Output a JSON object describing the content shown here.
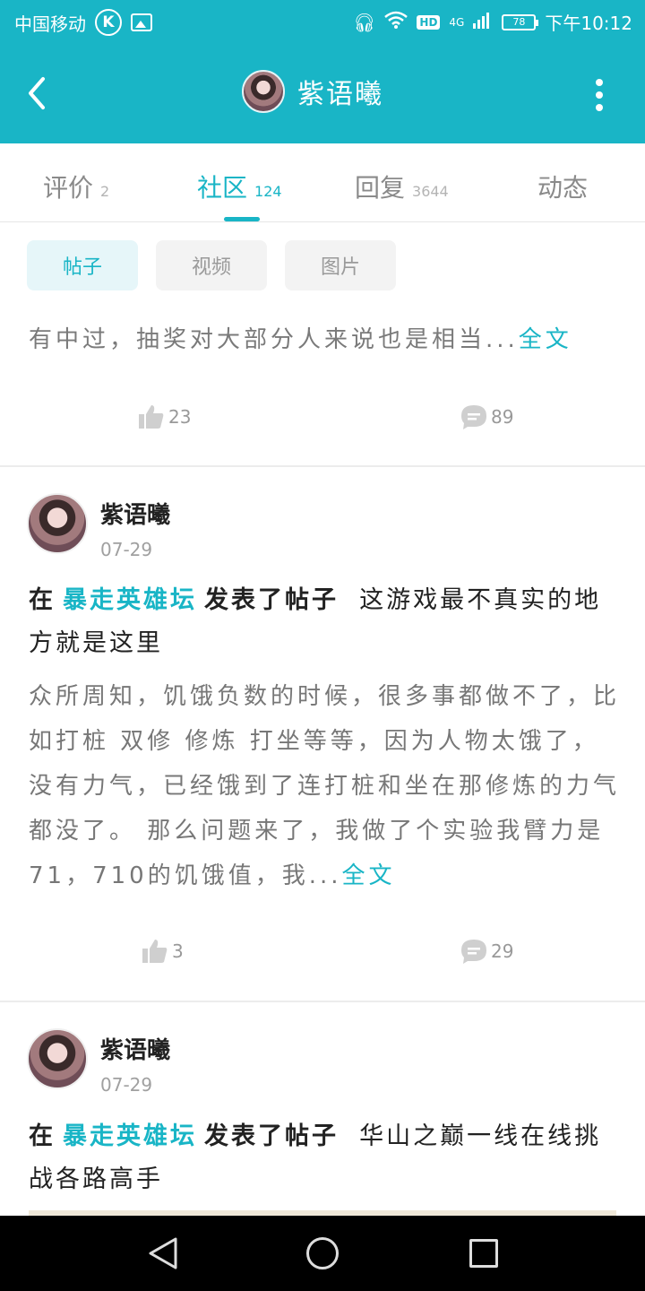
{
  "status_bar": {
    "carrier": "中国移动",
    "time": "下午10:12",
    "battery": "78",
    "network": "4G",
    "hd": "HD"
  },
  "header": {
    "title": "紫语曦",
    "back_icon": "back-arrow-icon",
    "more_icon": "more-vertical-icon"
  },
  "tabs": [
    {
      "label": "评价",
      "count": "2"
    },
    {
      "label": "社区",
      "count": "124"
    },
    {
      "label": "回复",
      "count": "3644"
    },
    {
      "label": "动态",
      "count": ""
    }
  ],
  "filter_chips": [
    "帖子",
    "视频",
    "图片"
  ],
  "posts": [
    {
      "excerpt": "有中过，抽奖对大部分人来说也是相当...",
      "more_label": "全文",
      "likes": "23",
      "comments": "89"
    },
    {
      "user": "紫语曦",
      "date": "07-29",
      "prefix": "在",
      "forum": "暴走英雄坛",
      "action": "发表了帖子",
      "title": "这游戏最不真实的地方就是这里",
      "body": "众所周知，饥饿负数的时候，很多事都做不了，比如打桩 双修 修炼 打坐等等，因为人物太饿了，没有力气，已经饿到了连打桩和坐在那修炼的力气都没了。 那么问题来了，我做了个实验我臂力是71，710的饥饿值，我...",
      "more_label": "全文",
      "likes": "3",
      "comments": "29"
    },
    {
      "user": "紫语曦",
      "date": "07-29",
      "prefix": "在",
      "forum": "暴走英雄坛",
      "action": "发表了帖子",
      "title": "华山之巅一线在线挑战各路高手"
    }
  ],
  "colors": {
    "accent": "#19b5c6",
    "text_dark": "#222222",
    "text_muted": "#777777"
  }
}
